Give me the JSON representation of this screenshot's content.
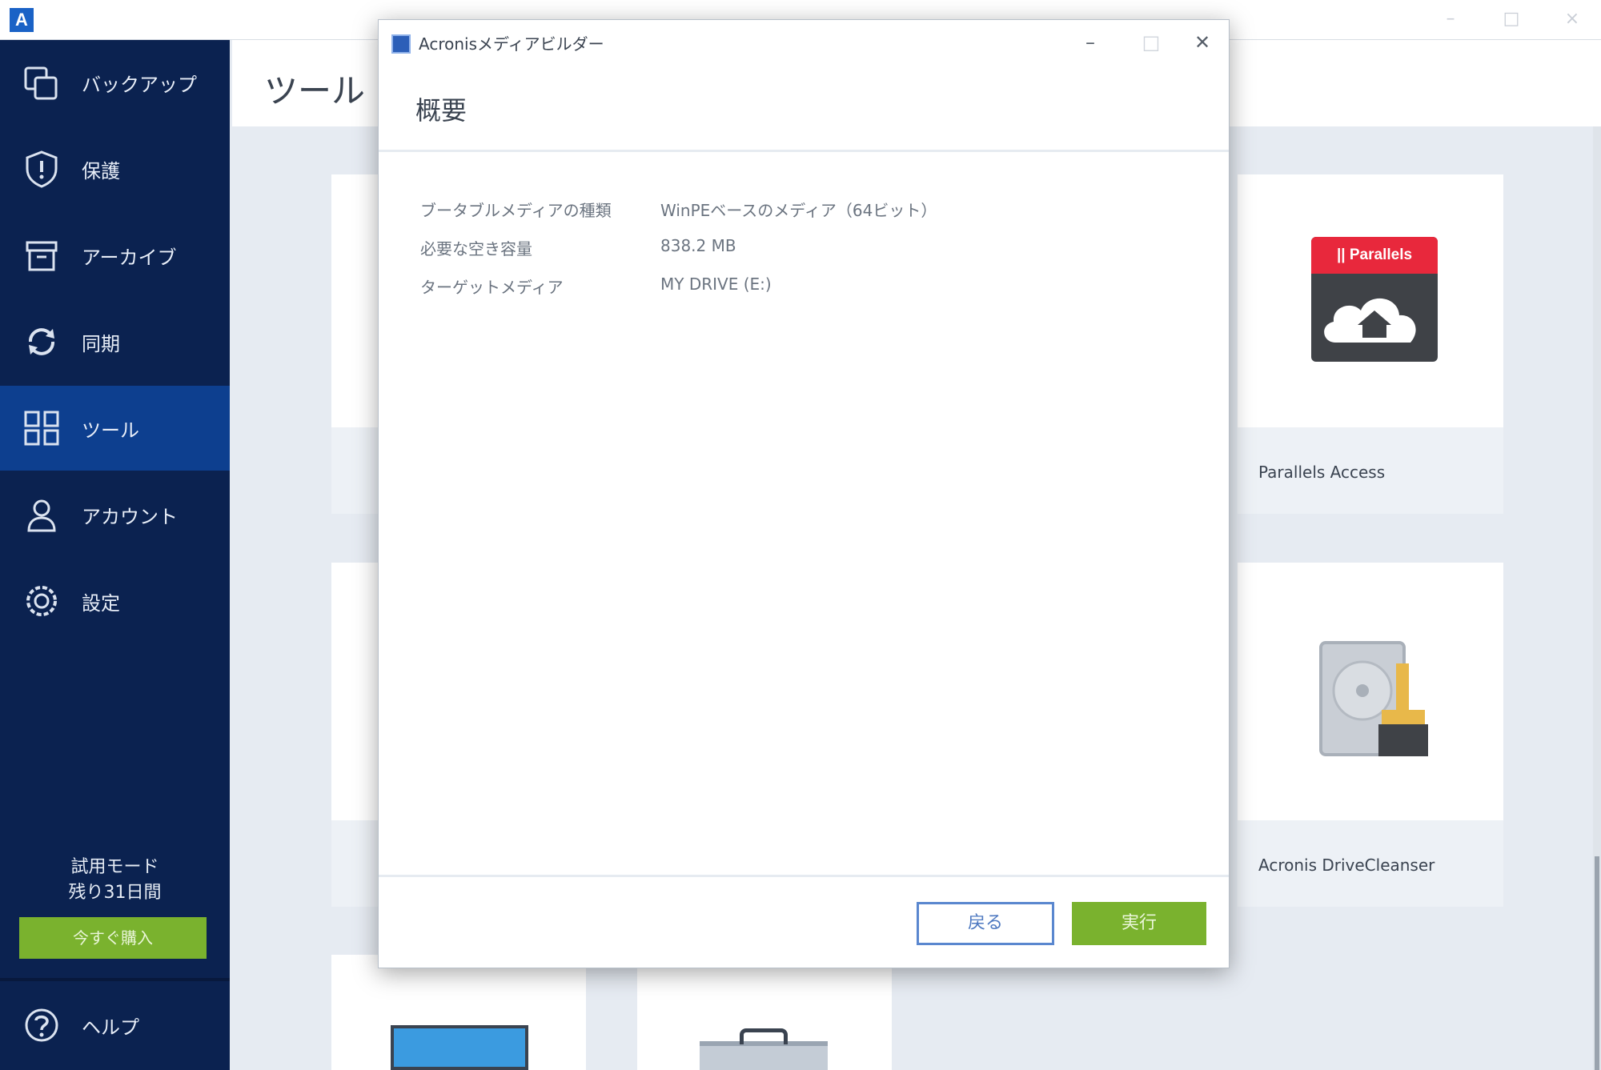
{
  "app": {
    "logo_letter": "A",
    "window_controls": {
      "minimize": "–",
      "maximize": "□",
      "close": "×"
    }
  },
  "sidebar": {
    "items": [
      {
        "id": "backup",
        "label": "バックアップ",
        "icon": "copy-icon"
      },
      {
        "id": "protection",
        "label": "保護",
        "icon": "shield-icon"
      },
      {
        "id": "archive",
        "label": "アーカイブ",
        "icon": "archive-icon"
      },
      {
        "id": "sync",
        "label": "同期",
        "icon": "sync-icon"
      },
      {
        "id": "tools",
        "label": "ツール",
        "icon": "tools-icon",
        "active": true
      },
      {
        "id": "account",
        "label": "アカウント",
        "icon": "user-icon"
      },
      {
        "id": "settings",
        "label": "設定",
        "icon": "gear-icon"
      },
      {
        "id": "help",
        "label": "ヘルプ",
        "icon": "help-icon"
      }
    ],
    "trial_mode": "試用モード",
    "trial_remaining": "残り31日間",
    "buy_button": "今すぐ購入"
  },
  "main": {
    "title": "ツール",
    "cards": [
      {
        "label": "Parallels Access",
        "icon": "parallels-access-icon",
        "brand_text": "|| Parallels"
      },
      {
        "label": "Acronis DriveCleanser",
        "icon": "drive-cleanser-icon"
      }
    ]
  },
  "dialog": {
    "title": "Acronisメディアビルダー",
    "controls": {
      "minimize": "–",
      "maximize": "□",
      "close": "✕"
    },
    "heading": "概要",
    "summary": [
      {
        "label": "ブータブルメディアの種類",
        "value": "WinPEベースのメディア（64ビット）"
      },
      {
        "label": "必要な空き容量",
        "value": "838.2 MB"
      },
      {
        "label": "ターゲットメディア",
        "value": "MY DRIVE (E:)"
      }
    ],
    "back_button": "戻る",
    "execute_button": "実行"
  },
  "colors": {
    "sidebar_bg": "#0b2250",
    "sidebar_active": "#0d3f8f",
    "accent_green": "#7ab22e",
    "accent_blue": "#1a62c6",
    "parallels_red": "#e8283c"
  }
}
